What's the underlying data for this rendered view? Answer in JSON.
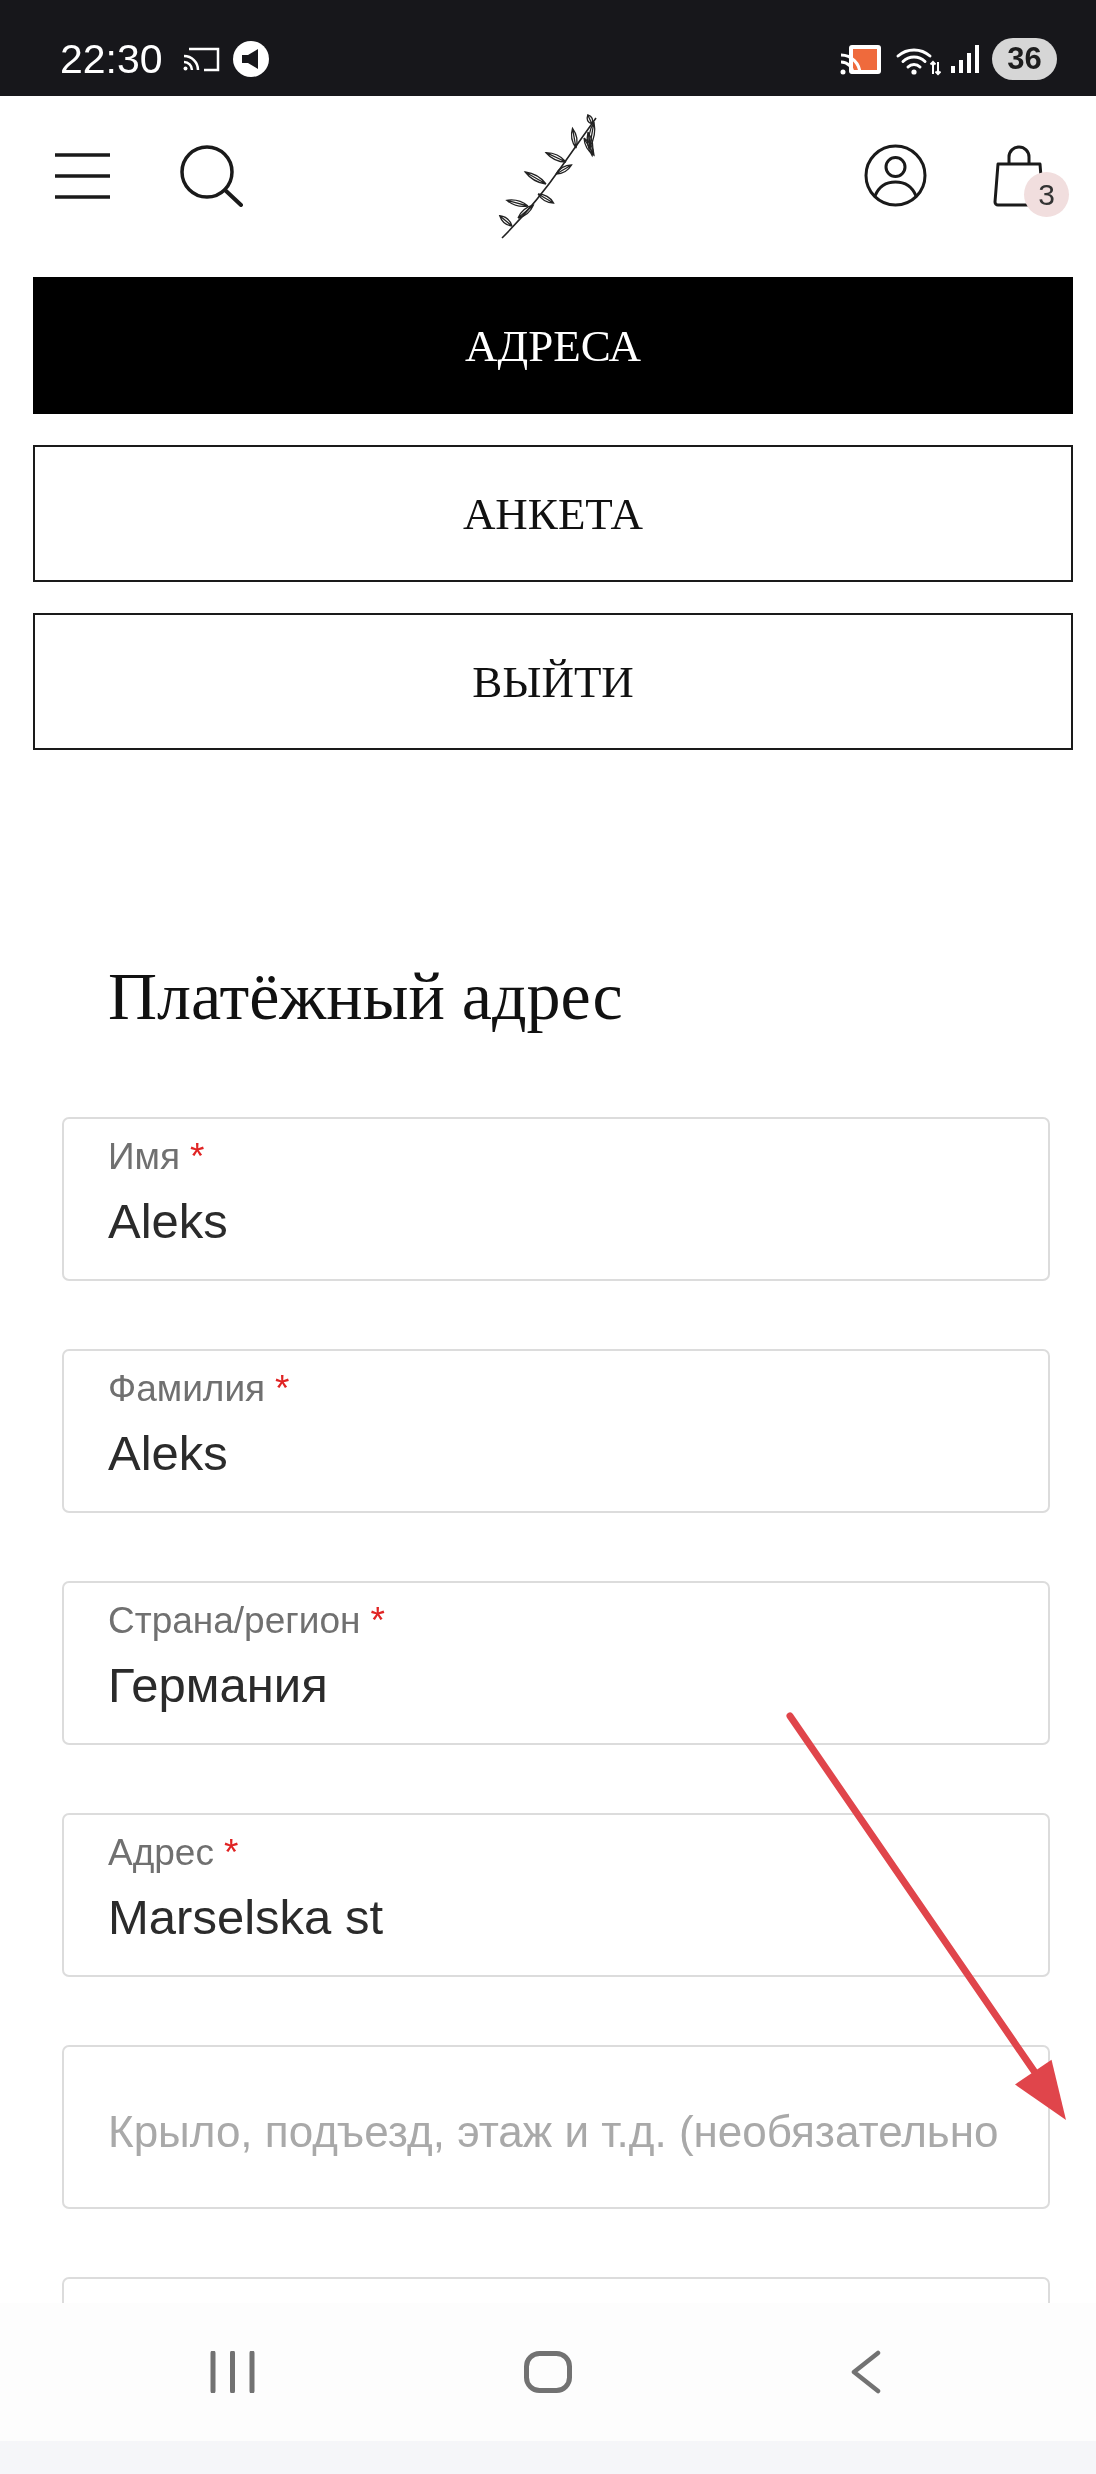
{
  "status_bar": {
    "time": "22:30",
    "battery": "36"
  },
  "header": {
    "cart_count": "3"
  },
  "account_nav": [
    {
      "label": "АДРЕСА",
      "selected": true
    },
    {
      "label": "АНКЕТА",
      "selected": false
    },
    {
      "label": "ВЫЙТИ",
      "selected": false
    }
  ],
  "billing_address": {
    "title": "Платёжный адрес",
    "fields": [
      {
        "kind": "floating",
        "label": "Имя",
        "required_mark": "*",
        "value": "Aleks"
      },
      {
        "kind": "floating",
        "label": "Фамилия",
        "required_mark": "*",
        "value": "Aleks"
      },
      {
        "kind": "floating",
        "label": "Страна/регион",
        "required_mark": "*",
        "value": "Германия"
      },
      {
        "kind": "floating",
        "label": "Адрес",
        "required_mark": "*",
        "value": "Marselska st"
      },
      {
        "kind": "plain",
        "placeholder": "Крыло, подъезд, этаж и т.д. (необязательно"
      },
      {
        "kind": "floating"
      }
    ]
  }
}
